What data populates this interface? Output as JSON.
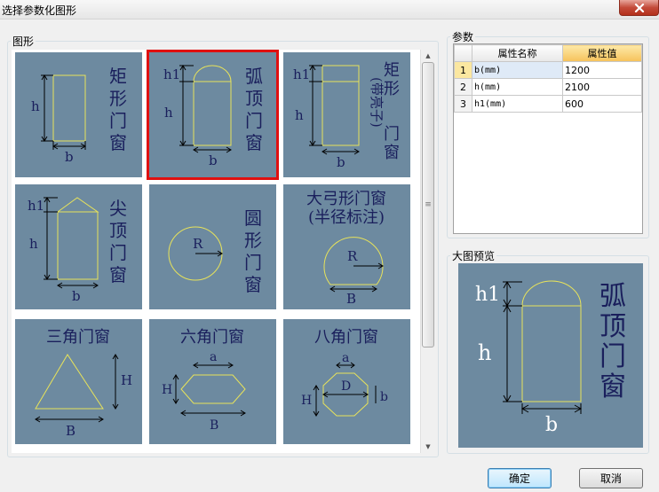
{
  "window": {
    "title": "选择参数化图形"
  },
  "shapes_group": {
    "label": "图形"
  },
  "params_group": {
    "label": "参数"
  },
  "preview_group": {
    "label": "大图预览"
  },
  "tiles": [
    {
      "lines": [
        "矩",
        "形",
        "门",
        "窗"
      ],
      "dims": [
        "h",
        "b"
      ]
    },
    {
      "lines": [
        "弧",
        "顶",
        "门",
        "窗"
      ],
      "dims": [
        "h1",
        "h",
        "b"
      ],
      "selected": true
    },
    {
      "lines": [
        "矩",
        "形",
        "门",
        "窗"
      ],
      "paren": "(带亮子)",
      "dims": [
        "h1",
        "h",
        "b"
      ]
    },
    {
      "lines": [
        "尖",
        "顶",
        "门",
        "窗"
      ],
      "dims": [
        "h1",
        "h",
        "b"
      ]
    },
    {
      "lines": [
        "圆",
        "形",
        "门",
        "窗"
      ],
      "dims": [
        "R"
      ]
    },
    {
      "title1": "大弓形门窗",
      "title2": "(半径标注)",
      "dims": [
        "R",
        "B"
      ]
    },
    {
      "title1": "三角门窗",
      "dims": [
        "H",
        "B"
      ]
    },
    {
      "title1": "六角门窗",
      "dims": [
        "a",
        "H",
        "B"
      ]
    },
    {
      "title1": "八角门窗",
      "dims": [
        "a",
        "D",
        "H",
        "b"
      ]
    }
  ],
  "grid": {
    "headers": [
      "属性名称",
      "属性值"
    ],
    "rows": [
      {
        "num": "1",
        "name": "b(mm)",
        "value": "1200"
      },
      {
        "num": "2",
        "name": "h(mm)",
        "value": "2100"
      },
      {
        "num": "3",
        "name": "h1(mm)",
        "value": "600"
      }
    ]
  },
  "preview": {
    "lines": [
      "弧",
      "顶",
      "门",
      "窗"
    ],
    "dims": [
      "h1",
      "h",
      "b"
    ]
  },
  "buttons": {
    "ok": "确定",
    "cancel": "取消"
  },
  "colors": {
    "tile_bg": "#6d8aa0",
    "shape_stroke": "#e8e35a",
    "selected_border": "#e01010",
    "label_text": "#1a1f5c"
  }
}
